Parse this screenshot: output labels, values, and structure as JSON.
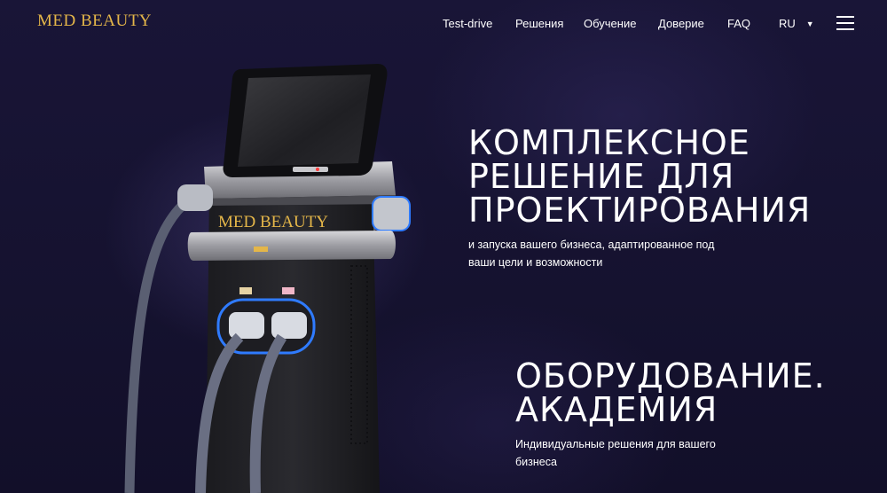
{
  "header": {
    "logo": "MED BEAUTY",
    "nav": [
      {
        "label": "Test-drive"
      },
      {
        "label": "Решения"
      },
      {
        "label": "Обучение"
      },
      {
        "label": "Доверие"
      },
      {
        "label": "FAQ"
      }
    ],
    "language": "RU",
    "menu_icon": "hamburger-menu-icon"
  },
  "device": {
    "brand_label": "MED BEAUTY",
    "accent_color": "#2f7bff"
  },
  "hero": {
    "title_lines": [
      "КОМПЛЕКСНОЕ",
      "РЕШЕНИЕ ДЛЯ",
      "ПРОЕКТИРОВАНИЯ"
    ],
    "subtitle": "и запуска вашего бизнеса, адаптированное под ваши цели и возможности",
    "title2_lines": [
      "ОБОРУДОВАНИЕ.",
      "АКАДЕМИЯ"
    ],
    "subtitle2": "Индивидуальные решения для вашего бизнеса"
  },
  "colors": {
    "background": "#15122f",
    "logo_gold": "#e4b649",
    "text": "#ffffff"
  }
}
